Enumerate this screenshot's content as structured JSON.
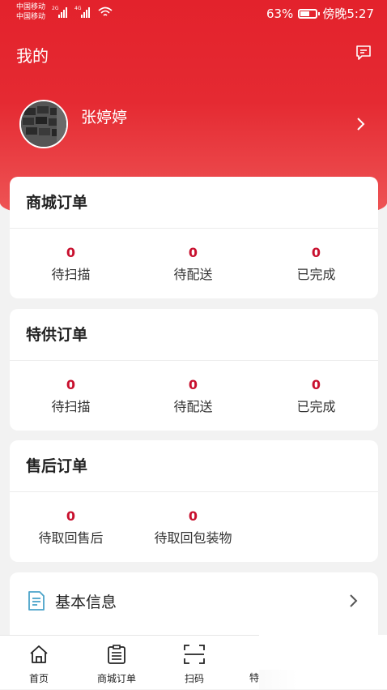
{
  "status_bar": {
    "carrier1": "中国移动",
    "carrier2": "中国移动",
    "net1": "2G",
    "net2": "4G",
    "battery_text": "63%",
    "battery_level": 0.63,
    "time": "傍晚5:27"
  },
  "header": {
    "title": "我的",
    "message_icon": "message-square-icon"
  },
  "profile": {
    "name": "张婷婷"
  },
  "cards": [
    {
      "title": "商城订单",
      "stats": [
        {
          "value": "0",
          "label": "待扫描"
        },
        {
          "value": "0",
          "label": "待配送"
        },
        {
          "value": "0",
          "label": "已完成"
        }
      ]
    },
    {
      "title": "特供订单",
      "stats": [
        {
          "value": "0",
          "label": "待扫描"
        },
        {
          "value": "0",
          "label": "待配送"
        },
        {
          "value": "0",
          "label": "已完成"
        }
      ]
    },
    {
      "title": "售后订单",
      "stats": [
        {
          "value": "0",
          "label": "待取回售后"
        },
        {
          "value": "0",
          "label": "待取回包装物"
        }
      ]
    }
  ],
  "info": {
    "label": "基本信息",
    "icon": "document-icon"
  },
  "tabbar": {
    "tabs": [
      {
        "label": "首页",
        "icon": "home-icon"
      },
      {
        "label": "商城订单",
        "icon": "clipboard-list-icon"
      },
      {
        "label": "扫码",
        "icon": "scan-icon"
      }
    ],
    "partial_label": "特"
  },
  "colors": {
    "brand_red": "#e3222c",
    "count_red": "#c8102e",
    "info_icon": "#4aa3c9"
  }
}
